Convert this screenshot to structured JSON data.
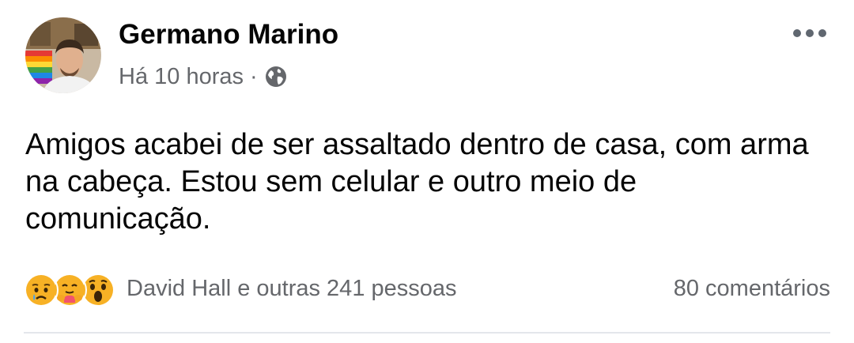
{
  "post": {
    "author": {
      "name": "Germano Marino",
      "avatar_icon": "profile-photo"
    },
    "meta": {
      "time": "Há 10 horas",
      "separator": "·",
      "privacy_icon": "globe-icon"
    },
    "more_icon": "more-horizontal-icon",
    "text": "Amigos acabei de ser assaltado dentro de casa, com arma na cabeça. Estou sem celular e outro meio de comunicação.",
    "reactions": {
      "icons": [
        "sad-reaction-icon",
        "care-reaction-icon",
        "wow-reaction-icon"
      ],
      "summary": "David Hall e outras 241 pessoas"
    },
    "comments": "80 comentários"
  },
  "colors": {
    "text_primary": "#050505",
    "text_secondary": "#65676b",
    "divider": "#e4e6eb",
    "reaction_yellow": "#f7b125"
  }
}
